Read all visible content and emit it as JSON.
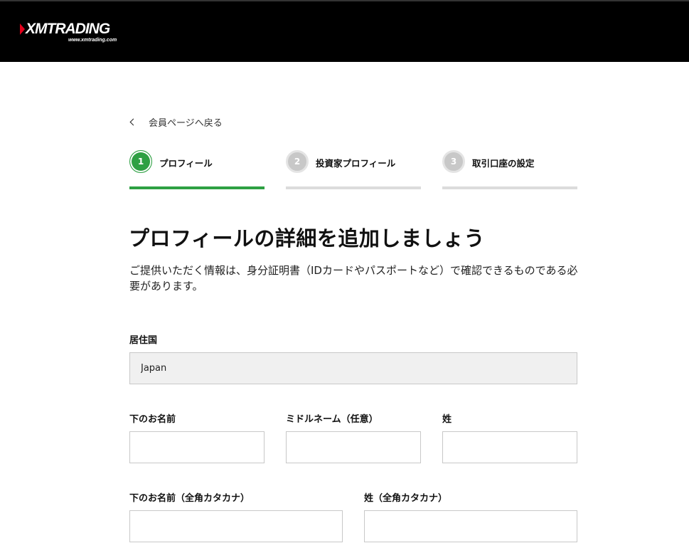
{
  "header": {
    "logo_text": "XMTRADING",
    "logo_sub": "www.xmtrading.com"
  },
  "back": {
    "label": "会員ページへ戻る"
  },
  "steps": [
    {
      "number": "1",
      "label": "プロフィール",
      "state": "active"
    },
    {
      "number": "2",
      "label": "投資家プロフィール",
      "state": "inactive"
    },
    {
      "number": "3",
      "label": "取引口座の設定",
      "state": "inactive"
    }
  ],
  "colors": {
    "accent": "#2ea043",
    "header_bg": "#000000",
    "logo_mark": "#e3001b"
  },
  "page": {
    "title": "プロフィールの詳細を追加しましょう",
    "description": "ご提供いただく情報は、身分証明書（IDカードやパスポートなど）で確認できるものである必要があります。"
  },
  "form": {
    "country": {
      "label": "居住国",
      "value": "Japan"
    },
    "first_name": {
      "label": "下のお名前",
      "value": ""
    },
    "middle_name": {
      "label": "ミドルネーム（任意）",
      "value": ""
    },
    "last_name": {
      "label": "姓",
      "value": ""
    },
    "first_name_kana": {
      "label": "下のお名前（全角カタカナ）",
      "value": ""
    },
    "last_name_kana": {
      "label": "姓（全角カタカナ）",
      "value": ""
    }
  }
}
